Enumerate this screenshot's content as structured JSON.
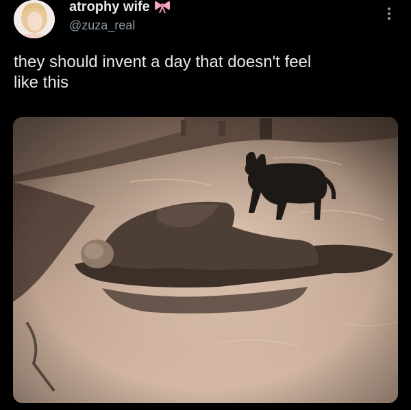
{
  "tweet": {
    "display_name": "atrophy wife",
    "handle": "@zuza_real",
    "text": "they should invent a day that doesn't feel\nlike this",
    "name_badge_icon": "pink-bow-icon",
    "menu_icon": "more-vertical-icon",
    "avatar_icon": "user-avatar",
    "photo_icon": "sepia-photo-man-lying-in-water-with-dog"
  },
  "colors": {
    "background": "#000000",
    "text_primary": "#e7e9ea",
    "text_secondary": "#8b98a5",
    "bow": "#f4a6c6"
  }
}
